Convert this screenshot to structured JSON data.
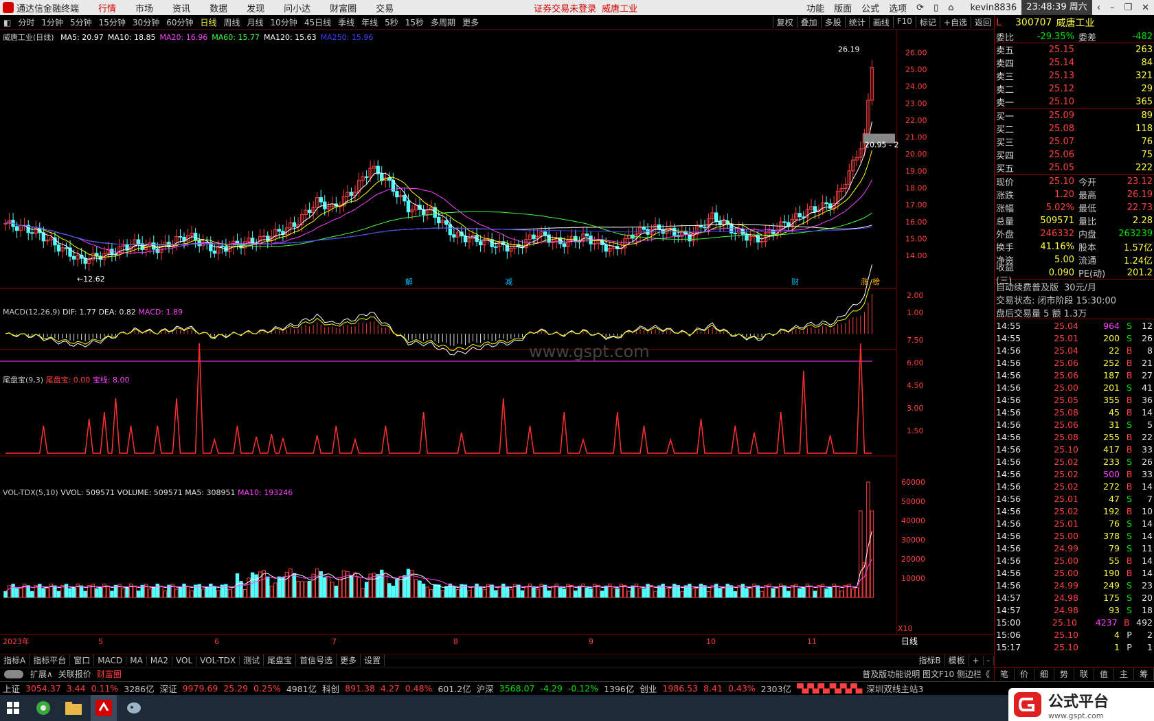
{
  "app": {
    "title": "通达信金融终端",
    "nav": [
      "行情",
      "市场",
      "资讯",
      "数据",
      "发现",
      "问小达",
      "财富圈",
      "交易"
    ],
    "warning": "证券交易未登录",
    "stock_name": "威唐工业",
    "right_menu": [
      "功能",
      "版面",
      "公式",
      "选项"
    ],
    "user": "kevin8836",
    "clock": "23:48:39 周六"
  },
  "periods": [
    "分时",
    "1分钟",
    "5分钟",
    "15分钟",
    "30分钟",
    "60分钟",
    "日线",
    "周线",
    "月线",
    "10分钟",
    "45日线",
    "季线",
    "年线",
    "5秒",
    "15秒",
    "多周期",
    "更多"
  ],
  "chart_tools": [
    "复权",
    "叠加",
    "多股",
    "统计",
    "画线",
    "F10",
    "标记",
    "+自选",
    "返回"
  ],
  "main": {
    "title": "威唐工业(日线)",
    "ma": [
      {
        "label": "MA5: 20.97",
        "color": "#ffffff"
      },
      {
        "label": "MA10: 18.85",
        "color": "#ffffff"
      },
      {
        "label": "MA20: 16.96",
        "color": "#ff40ff"
      },
      {
        "label": "MA60: 15.77",
        "color": "#40ff40"
      },
      {
        "label": "MA120: 15.63",
        "color": "#ffffff"
      },
      {
        "label": "MA250: 15.96",
        "color": "#4040ff"
      }
    ],
    "hi_label": "26.19",
    "lo_label": "12.62",
    "price_tag": "20.95 - 2",
    "yaxis": [
      "26.00",
      "25.00",
      "24.00",
      "23.00",
      "22.00",
      "21.00",
      "20.00",
      "19.00",
      "18.00",
      "17.00",
      "16.00",
      "15.00",
      "14.00"
    ],
    "events": [
      "解",
      "减",
      "财",
      "涨",
      "榜"
    ]
  },
  "macd": {
    "title": "MACD(12,26,9)",
    "dif": "DIF: 1.77",
    "dea": "DEA: 0.82",
    "macd": "MACD: 1.89",
    "yaxis": [
      "2.00",
      "1.00"
    ]
  },
  "wpb": {
    "title": "尾盘宝(9,3)",
    "a": "尾盘宝: 0.00",
    "b": "宝线: 8.00",
    "yaxis": [
      "7.50",
      "6.00",
      "4.50",
      "3.00",
      "1.50"
    ]
  },
  "vol": {
    "title": "VOL-TDX(5,10)",
    "vvol": "VVOL: 509571",
    "volume": "VOLUME: 509571",
    "ma5": "MA5: 308951",
    "ma10": "MA10: 193246",
    "yaxis": [
      "60000",
      "50000",
      "40000",
      "30000",
      "20000",
      "10000"
    ],
    "unit": "X10"
  },
  "xaxis": {
    "labels": [
      "2023年",
      "5",
      "6",
      "7",
      "8",
      "9",
      "10",
      "11"
    ],
    "right": "日线"
  },
  "bottom_tabs": [
    "指标A",
    "指标平台",
    "窗口",
    "MACD",
    "MA",
    "MA2",
    "VOL",
    "VOL-TDX",
    "测试",
    "尾盘宝",
    "首信号选",
    "更多",
    "设置"
  ],
  "bottom_tabs2": [
    "扩展∧",
    "关联报价",
    "财富圈"
  ],
  "bottom_right": [
    "指标B",
    "模板",
    "+",
    "-"
  ],
  "help_text": "普及版功能说明 图文F10 侧边栏《",
  "quote": {
    "code": "300707",
    "name": "威唐工业",
    "wb": [
      "委比",
      "-29.35%",
      "委差",
      "-482"
    ],
    "asks": [
      [
        "卖五",
        "25.15",
        "263"
      ],
      [
        "卖四",
        "25.14",
        "84"
      ],
      [
        "卖三",
        "25.13",
        "321"
      ],
      [
        "卖二",
        "25.12",
        "29"
      ],
      [
        "卖一",
        "25.10",
        "365"
      ]
    ],
    "bids": [
      [
        "买一",
        "25.09",
        "89"
      ],
      [
        "买二",
        "25.08",
        "118"
      ],
      [
        "买三",
        "25.07",
        "76"
      ],
      [
        "买四",
        "25.06",
        "75"
      ],
      [
        "买五",
        "25.05",
        "222"
      ]
    ],
    "stats": [
      [
        "现价",
        "25.10",
        "今开",
        "23.12"
      ],
      [
        "涨跌",
        "1.20",
        "最高",
        "26.19"
      ],
      [
        "涨幅",
        "5.02%",
        "最低",
        "22.73"
      ],
      [
        "总量",
        "509571",
        "量比",
        "2.28"
      ],
      [
        "外盘",
        "246332",
        "内盘",
        "263239"
      ],
      [
        "换手",
        "41.16%",
        "股本",
        "1.57亿"
      ],
      [
        "净资",
        "5.00",
        "流通",
        "1.24亿"
      ],
      [
        "收益(三)",
        "0.090",
        "PE(动)",
        "201.2"
      ]
    ],
    "promo": [
      "自动续费普及版",
      "30元/月"
    ],
    "trade_status": "交易状态: 闭市阶段 15:30:00",
    "after_hours": "盘后交易量 5 额 1.3万",
    "ticks": [
      [
        "14:55",
        "25.04",
        "964",
        "S",
        "12"
      ],
      [
        "14:55",
        "25.01",
        "200",
        "S",
        "26"
      ],
      [
        "14:56",
        "25.04",
        "22",
        "B",
        "8"
      ],
      [
        "14:56",
        "25.06",
        "252",
        "B",
        "21"
      ],
      [
        "14:56",
        "25.06",
        "187",
        "B",
        "27"
      ],
      [
        "14:56",
        "25.00",
        "201",
        "S",
        "41"
      ],
      [
        "14:56",
        "25.05",
        "355",
        "B",
        "36"
      ],
      [
        "14:56",
        "25.08",
        "45",
        "B",
        "14"
      ],
      [
        "14:56",
        "25.06",
        "31",
        "S",
        "5"
      ],
      [
        "14:56",
        "25.08",
        "255",
        "B",
        "22"
      ],
      [
        "14:56",
        "25.10",
        "417",
        "B",
        "33"
      ],
      [
        "14:56",
        "25.02",
        "233",
        "S",
        "26"
      ],
      [
        "14:56",
        "25.02",
        "500",
        "B",
        "33"
      ],
      [
        "14:56",
        "25.02",
        "272",
        "B",
        "14"
      ],
      [
        "14:56",
        "25.01",
        "47",
        "S",
        "7"
      ],
      [
        "14:56",
        "25.02",
        "192",
        "B",
        "10"
      ],
      [
        "14:56",
        "25.01",
        "76",
        "S",
        "14"
      ],
      [
        "14:56",
        "25.00",
        "378",
        "S",
        "14"
      ],
      [
        "14:56",
        "24.99",
        "79",
        "S",
        "11"
      ],
      [
        "14:56",
        "25.00",
        "55",
        "B",
        "14"
      ],
      [
        "14:56",
        "25.00",
        "190",
        "B",
        "14"
      ],
      [
        "14:56",
        "24.99",
        "249",
        "S",
        "23"
      ],
      [
        "14:57",
        "24.98",
        "175",
        "S",
        "20"
      ],
      [
        "14:57",
        "24.98",
        "93",
        "S",
        "18"
      ],
      [
        "15:00",
        "25.10",
        "4237",
        "B",
        "492"
      ],
      [
        "15:06",
        "25.10",
        "4",
        "P",
        "2"
      ],
      [
        "15:17",
        "25.10",
        "1",
        "P",
        "1"
      ]
    ],
    "tabs": [
      "笔",
      "价",
      "细",
      "势",
      "联",
      "值",
      "主",
      "筹"
    ]
  },
  "status": {
    "sh": [
      "上证",
      "3054.37",
      "3.44",
      "0.11%",
      "3286亿"
    ],
    "sz": [
      "深证",
      "9979.69",
      "25.29",
      "0.25%",
      "4981亿"
    ],
    "kc": [
      "科创",
      "891.38",
      "4.27",
      "0.48%",
      "601.2亿"
    ],
    "hs": [
      "沪深",
      "3568.07",
      "-4.29",
      "-0.12%",
      "1396亿"
    ],
    "cy": [
      "创业",
      "1986.53",
      "8.41",
      "0.43%",
      "2303亿"
    ],
    "server": "深圳双线主站3"
  },
  "watermark": "www.gspt.com",
  "corner_logo": "公式平台",
  "corner_url": "www.gspt.com"
}
